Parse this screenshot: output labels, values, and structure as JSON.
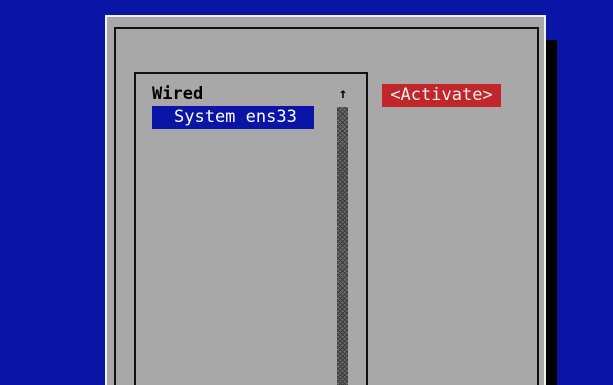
{
  "connections": {
    "groups": [
      {
        "label": "Wired",
        "items": [
          {
            "label": "System ens33",
            "selected": true
          }
        ]
      }
    ]
  },
  "scrollbar": {
    "up_arrow": "↑"
  },
  "actions": {
    "activate_label": "<Activate>"
  },
  "colors": {
    "background": "#0a15a8",
    "dialog": "#a8a8a8",
    "selection": "#0a15a8",
    "button": "#c0262a",
    "button_text": "#f2f2f2"
  }
}
